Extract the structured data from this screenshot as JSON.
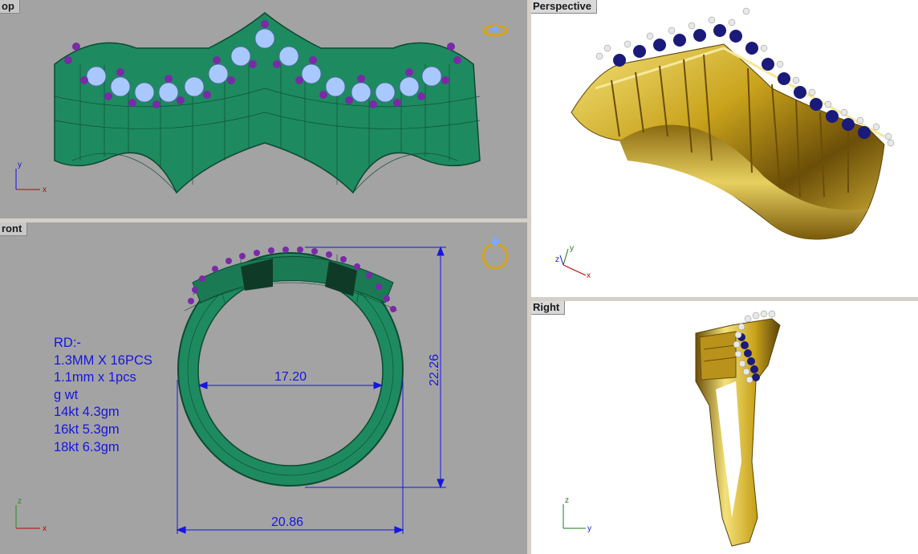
{
  "viewports": {
    "top": {
      "label": "op"
    },
    "front": {
      "label": "ront"
    },
    "perspective": {
      "label": "Perspective"
    },
    "right": {
      "label": "Right"
    }
  },
  "notes": {
    "lines": [
      "RD:-",
      "1.3MM X 16PCS",
      "1.1mm x 1pcs",
      "g wt",
      "14kt 4.3gm",
      "16kt 5.3gm",
      "18kt 6.3gm"
    ]
  },
  "dimensions": {
    "inner_diameter": "17.20",
    "outer_width": "20.86",
    "height": "22.26"
  },
  "axes": {
    "top": {
      "v": "y",
      "h": "x"
    },
    "front": {
      "v": "z",
      "h": "x"
    },
    "perspective": {
      "v": "y",
      "h": "x",
      "d": "z"
    },
    "right": {
      "v": "z",
      "h": "y"
    }
  },
  "colors": {
    "viewport_gray": "#a3a3a3",
    "wireframe_green": "#1a7f5a",
    "dimension_blue": "#1616e0",
    "gold": "#c9a31c",
    "prong_purple": "#7a2aa8",
    "stone_light_blue": "#a9c8ff",
    "sapphire": "#1a1a7a"
  }
}
